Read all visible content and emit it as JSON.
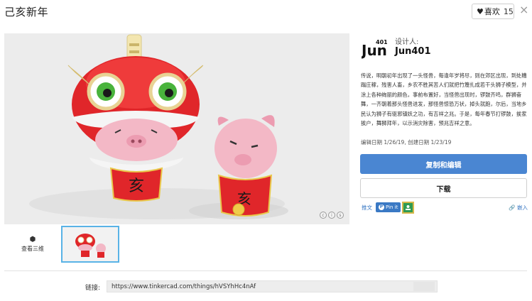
{
  "header": {
    "title": "己亥新年",
    "like_label": "喜欢",
    "like_count": "15",
    "close_label": "×"
  },
  "viewer": {
    "character_text": "亥"
  },
  "thumbnails": {
    "view_3d_label": "查看三维"
  },
  "designer": {
    "label": "设计人:",
    "name": "Jun401",
    "logo_text": "Jun",
    "logo_num": "401"
  },
  "description": "传说，明朝初年出现了一头怪兽，每逢年岁将尽，则在郊区出现，到处糟蹋庄稼，残害人畜，乡农不胜其苦人们就把竹篾扎成若干头狮子模型，并涂上各种绚丽的颜色，事前布置好，当怪兽出现时，锣鼓齐鸣，群狮奋舞，一齐朝着那头怪兽进发，那怪兽惊恐万状，掉头就跑，尔后，当地乡民认为狮子有驱邪镇妖之功，有吉祥之兆。于是，每年春节打锣鼓，挨家挨户，舞狮拜年，以示消灾除害，预兆吉祥之意。",
  "dates": "编辑日期 1/26/19, 创建日期 1/23/19",
  "actions": {
    "copy_edit": "复制和编辑",
    "download": "下载"
  },
  "share": {
    "tweet": "推文",
    "pin": "Pin it",
    "embed": "嵌入"
  },
  "link": {
    "label": "链接:",
    "url": "https://www.tinkercad.com/things/hVSYhHc4nAf"
  },
  "colors": {
    "primary": "#4a86d2",
    "link": "#3a79c4",
    "thumb_border": "#59b3e6"
  }
}
